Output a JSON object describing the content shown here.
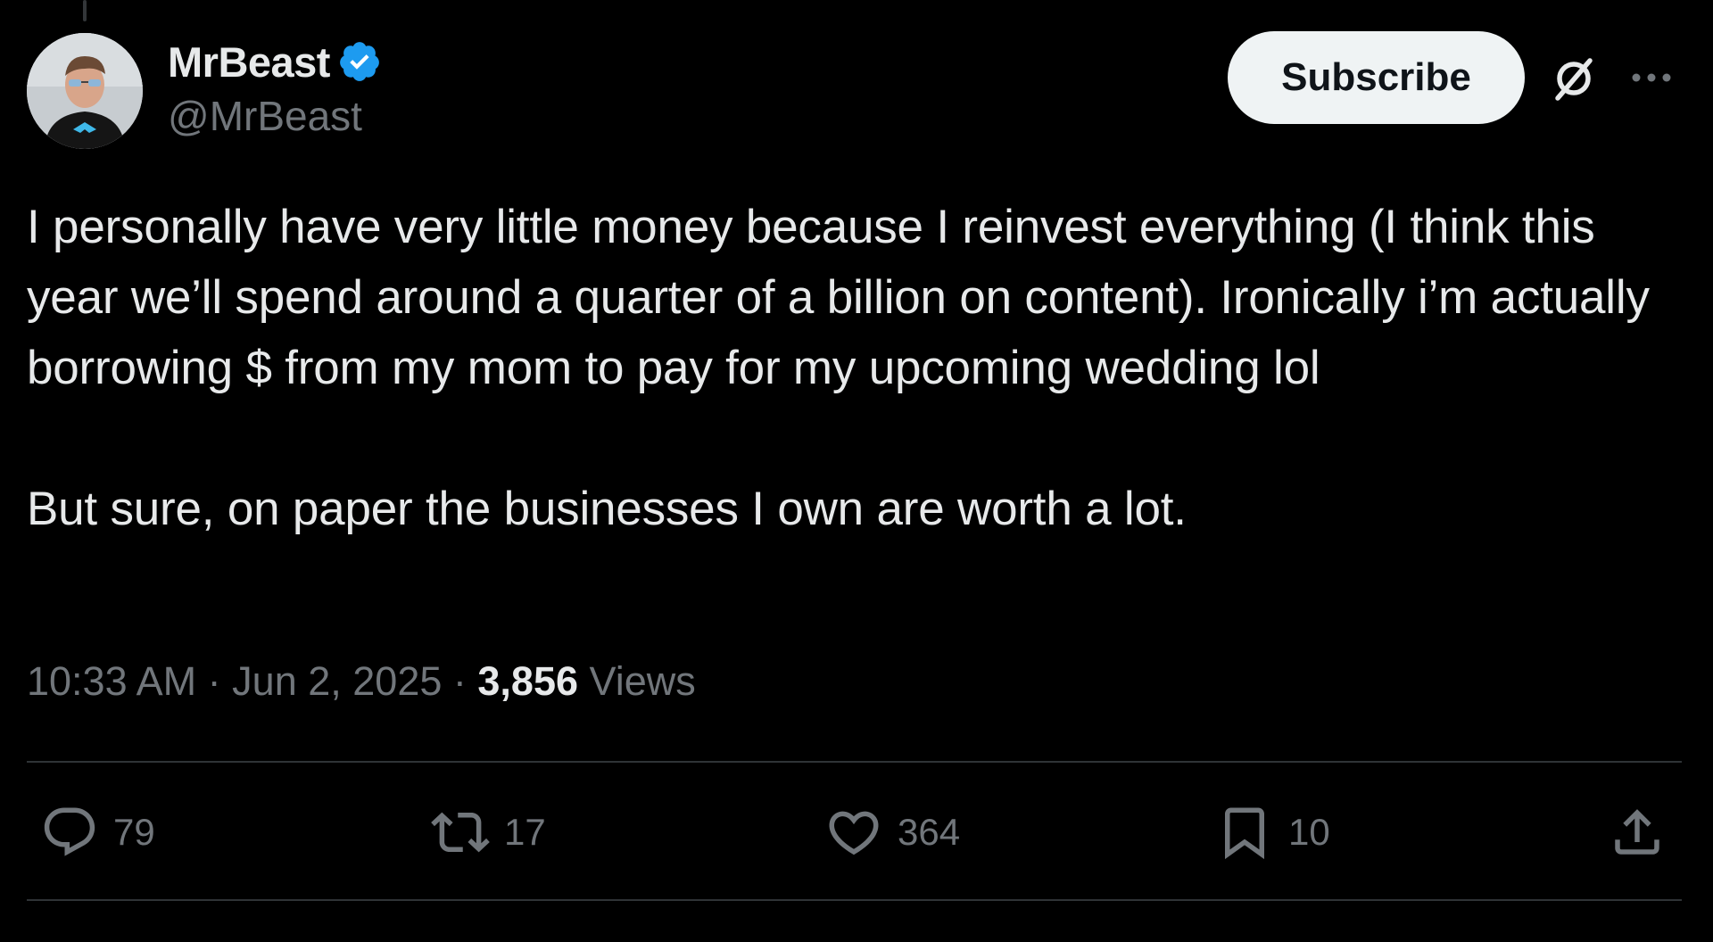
{
  "author": {
    "display_name": "MrBeast",
    "handle": "@MrBeast",
    "verified": true
  },
  "header": {
    "subscribe_label": "Subscribe"
  },
  "tweet": {
    "text": "I personally have very little money because I reinvest everything (I think this year we’ll spend around a quarter of a billion on content). Ironically i’m actually borrowing $ from my mom to pay for my upcoming wedding lol\n\nBut sure, on paper the businesses I own are worth a lot.",
    "time": "10:33 AM",
    "date": "Jun 2, 2025",
    "views_count": "3,856",
    "views_label": "Views",
    "separator": "·"
  },
  "actions": {
    "replies": "79",
    "reposts": "17",
    "likes": "364",
    "bookmarks": "10"
  },
  "icons": {
    "avatar": "avatar-image",
    "verified": "verified-badge-icon",
    "grok": "grok-icon",
    "more": "more-icon",
    "reply": "reply-icon",
    "repost": "repost-icon",
    "like": "heart-icon",
    "bookmark": "bookmark-icon",
    "share": "share-icon"
  },
  "colors": {
    "background": "#000000",
    "text_primary": "#e7e9ea",
    "text_secondary": "#71767b",
    "verified_blue": "#1d9bf0",
    "button_bg": "#eff3f4",
    "divider": "#2f3336"
  }
}
